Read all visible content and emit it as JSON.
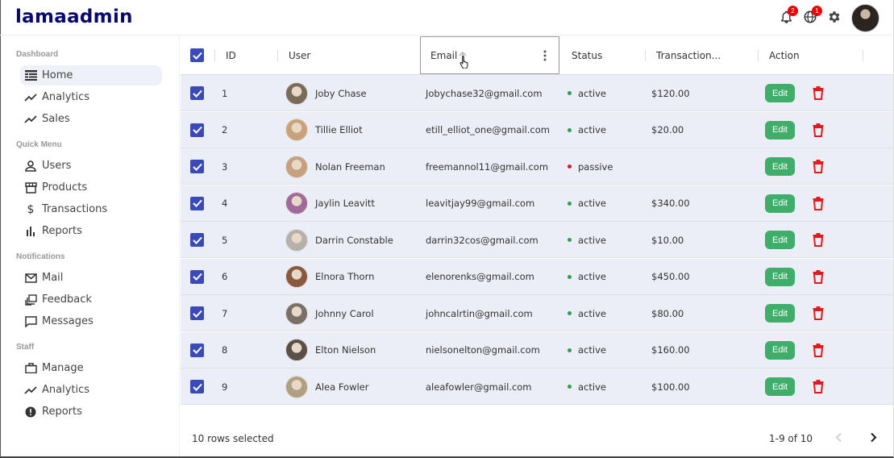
{
  "app": {
    "logo": "lamaadmin"
  },
  "topbar": {
    "notifications_count": "2",
    "language_count": "1"
  },
  "sidebar": {
    "sections": [
      {
        "title": "Dashboard",
        "items": [
          {
            "label": "Home",
            "icon": "home-grid-icon",
            "active": true
          },
          {
            "label": "Analytics",
            "icon": "trend-line-icon"
          },
          {
            "label": "Sales",
            "icon": "trend-line-icon"
          }
        ]
      },
      {
        "title": "Quick Menu",
        "items": [
          {
            "label": "Users",
            "icon": "user-icon"
          },
          {
            "label": "Products",
            "icon": "store-icon"
          },
          {
            "label": "Transactions",
            "icon": "dollar-icon"
          },
          {
            "label": "Reports",
            "icon": "bar-chart-icon"
          }
        ]
      },
      {
        "title": "Notifications",
        "items": [
          {
            "label": "Mail",
            "icon": "mail-icon"
          },
          {
            "label": "Feedback",
            "icon": "feedback-icon"
          },
          {
            "label": "Messages",
            "icon": "message-icon"
          }
        ]
      },
      {
        "title": "Staff",
        "items": [
          {
            "label": "Manage",
            "icon": "briefcase-icon"
          },
          {
            "label": "Analytics",
            "icon": "trend-line-icon"
          },
          {
            "label": "Reports",
            "icon": "report-icon"
          }
        ]
      }
    ]
  },
  "table": {
    "columns": [
      "ID",
      "User",
      "Email",
      "Status",
      "Transaction...",
      "Action"
    ],
    "edit_label": "Edit",
    "rows": [
      {
        "id": "1",
        "user": "Joby Chase",
        "email": "Jobychase32@gmail.com",
        "status": "active",
        "transaction": "$120.00"
      },
      {
        "id": "2",
        "user": "Tillie Elliot",
        "email": "etill_elliot_one@gmail.com",
        "status": "active",
        "transaction": "$20.00"
      },
      {
        "id": "3",
        "user": "Nolan Freeman",
        "email": "freemannol11@gmail.com",
        "status": "passive",
        "transaction": ""
      },
      {
        "id": "4",
        "user": "Jaylin Leavitt",
        "email": "leavitjay99@gmail.com",
        "status": "active",
        "transaction": "$340.00"
      },
      {
        "id": "5",
        "user": "Darrin Constable",
        "email": "darrin32cos@gmail.com",
        "status": "active",
        "transaction": "$10.00"
      },
      {
        "id": "6",
        "user": "Elnora Thorn",
        "email": "elenorenks@gmail.com",
        "status": "active",
        "transaction": "$450.00"
      },
      {
        "id": "7",
        "user": "Johnny Carol",
        "email": "johncalrtin@gmail.com",
        "status": "active",
        "transaction": "$80.00"
      },
      {
        "id": "8",
        "user": "Elton Nielson",
        "email": "nielsonelton@gmail.com",
        "status": "active",
        "transaction": "$160.00"
      },
      {
        "id": "9",
        "user": "Alea Fowler",
        "email": "aleafowler@gmail.com",
        "status": "active",
        "transaction": "$100.00"
      }
    ],
    "footer": {
      "selected": "10 rows selected",
      "pagination": "1-9 of 10"
    }
  },
  "colors": {
    "accent": "#3a4bb8",
    "logo": "#0a0a6e",
    "active_status": "#2e9e4f",
    "passive_status": "#e01b1b",
    "edit": "#3fae6a",
    "delete": "#e01b1b"
  }
}
